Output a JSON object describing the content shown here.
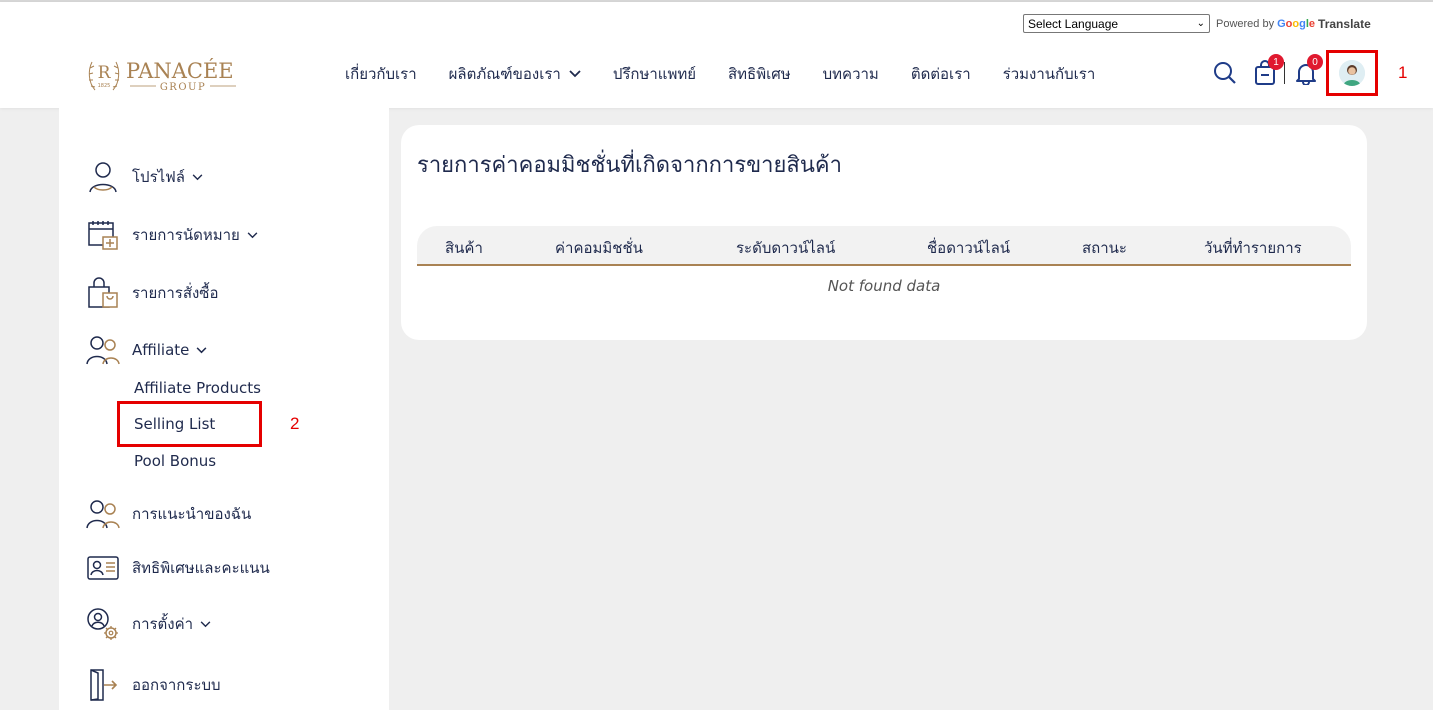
{
  "language": {
    "select_label": "Select Language",
    "powered_by": "Powered by",
    "google": "Google",
    "translate": "Translate"
  },
  "brand": {
    "name": "PANACÉE",
    "sub": "GROUP",
    "year": "1825",
    "mark": "R",
    "gold": "#a98253"
  },
  "nav": [
    {
      "label": "เกี่ยวกับเรา"
    },
    {
      "label": "ผลิตภัณฑ์ของเรา",
      "dropdown": true
    },
    {
      "label": "ปรึกษาแพทย์"
    },
    {
      "label": "สิทธิพิเศษ"
    },
    {
      "label": "บทความ"
    },
    {
      "label": "ติดต่อเรา"
    },
    {
      "label": "ร่วมงานกับเรา"
    }
  ],
  "header_icons": {
    "cart_count": "1",
    "notif_count": "0"
  },
  "annotations": {
    "marker_1": "1",
    "marker_2": "2",
    "color": "#e50000"
  },
  "sidebar": {
    "items": [
      {
        "label": "โปรไฟล์",
        "icon": "user-icon",
        "dropdown": true
      },
      {
        "label": "รายการนัดหมาย",
        "icon": "calendar-plus-icon",
        "dropdown": true
      },
      {
        "label": "รายการสั่งซื้อ",
        "icon": "shopping-bag-icon"
      },
      {
        "label": "Affiliate",
        "icon": "users-icon",
        "dropdown": true
      },
      {
        "label": "การแนะนำของฉัน",
        "icon": "referral-icon"
      },
      {
        "label": "สิทธิพิเศษและคะแนน",
        "icon": "id-card-icon"
      },
      {
        "label": "การตั้งค่า",
        "icon": "user-settings-icon",
        "dropdown": true
      },
      {
        "label": "ออกจากระบบ",
        "icon": "logout-icon"
      }
    ],
    "affiliate_sub": [
      "Affiliate Products",
      "Selling List",
      "Pool Bonus"
    ]
  },
  "content": {
    "title": "รายการค่าคอมมิชชั่นที่เกิดจากการขายสินค้า",
    "columns": [
      "สินค้า",
      "ค่าคอมมิชชั่น",
      "ระดับดาวน์ไลน์",
      "ชื่อดาวน์ไลน์",
      "สถานะ",
      "วันที่ทำรายการ"
    ],
    "empty_text": "Not found data"
  }
}
